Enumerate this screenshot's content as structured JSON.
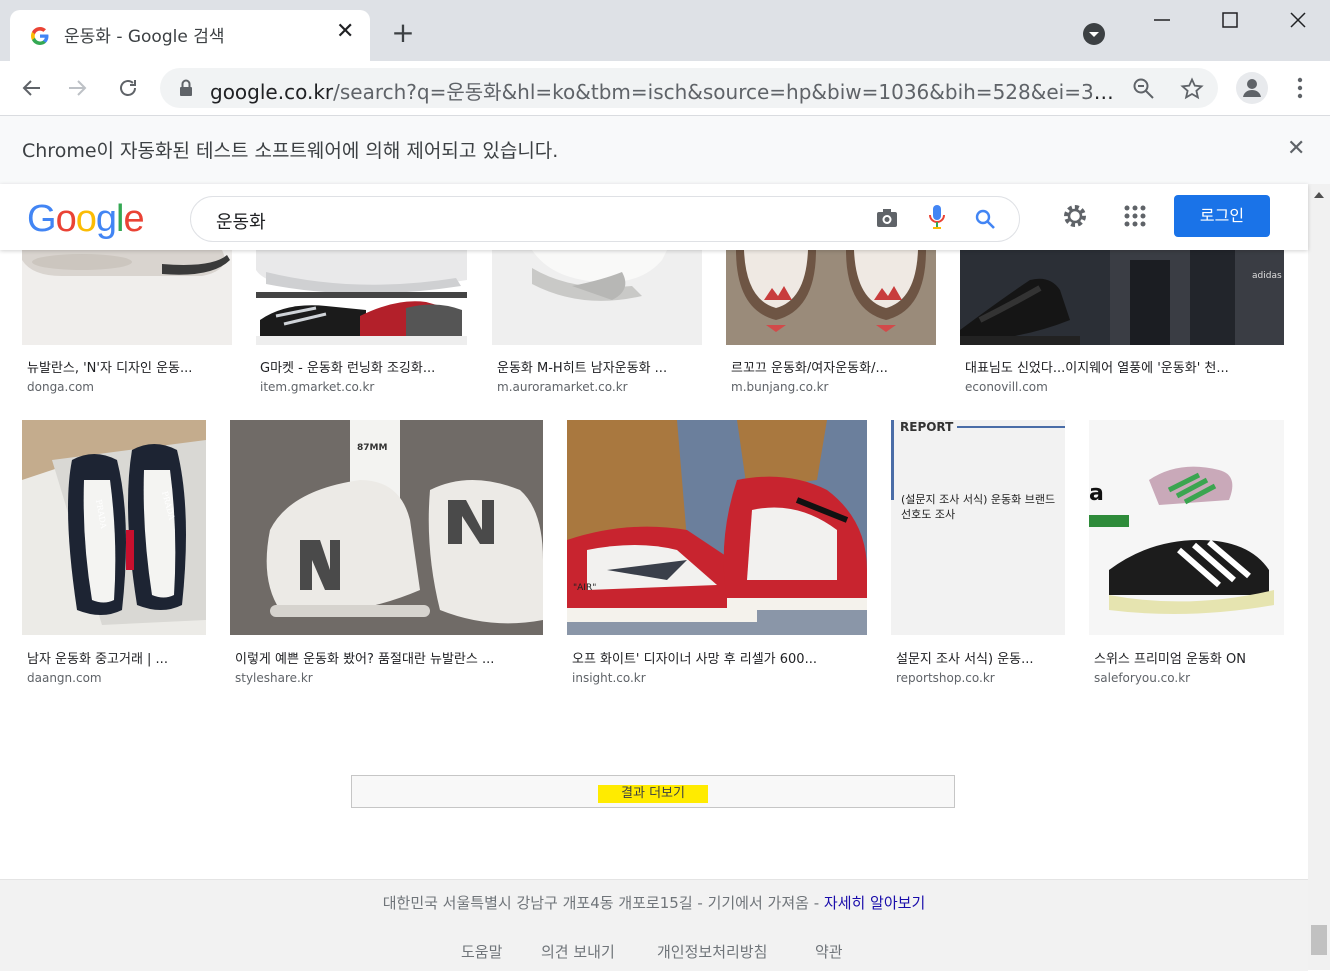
{
  "browser": {
    "tab_title": "운동화 - Google 검색",
    "new_tab": "+",
    "url_host": "google.co.kr",
    "url_rest": "/search?q=운동화&hl=ko&tbm=isch&source=hp&biw=1036&bih=528&ei=3THT...",
    "infobar_text": "Chrome이 자동화된 테스트 소프트웨어에 의해 제어되고 있습니다."
  },
  "header": {
    "logo": "Google",
    "query": "운동화",
    "signin": "로그인"
  },
  "results_row1": [
    {
      "caption": "뉴발란스, 'N'자 디자인 운동...",
      "source": "donga.com"
    },
    {
      "caption": "G마켓 - 운동화 런닝화 조깅화...",
      "source": "item.gmarket.co.kr"
    },
    {
      "caption": "운동화 M-H히트 남자운동화 ...",
      "source": "m.auroramarket.co.kr"
    },
    {
      "caption": "르꼬끄 운동화/여자운동화/...",
      "source": "m.bunjang.co.kr"
    },
    {
      "caption": "대표님도 신었다...이지웨어 열풍에 '운동화' 천...",
      "source": "econovill.com"
    }
  ],
  "results_row2": [
    {
      "caption": "남자 운동화 중고거래 | ...",
      "source": "daangn.com"
    },
    {
      "caption": "이렇게 예쁜 운동화 봤어? 품절대란 뉴발란스 ...",
      "source": "styleshare.kr"
    },
    {
      "caption": "오프 화이트' 디자이너 사망 후 리셀가 600...",
      "source": "insight.co.kr"
    },
    {
      "caption": "설문지 조사 서식) 운동...",
      "source": "reportshop.co.kr"
    },
    {
      "caption": "스위스 프리미엄 운동화 ON",
      "source": "saleforyou.co.kr"
    }
  ],
  "thumb_text": {
    "report_title": "REPORT",
    "report_body": "(설문지 조사 서식) 운동화 브랜드 선호도 조사",
    "sock_text": "87MM",
    "air_text": "\"AIR\""
  },
  "more_results": "결과 더보기",
  "footer": {
    "location": "대한민국 서울특별시 강남구 개포4동 개포로15길 - 기기에서 가져옴 - ",
    "learn_more": "자세히 알아보기",
    "links": [
      "도움말",
      "의견 보내기",
      "개인정보처리방침",
      "약관"
    ]
  }
}
